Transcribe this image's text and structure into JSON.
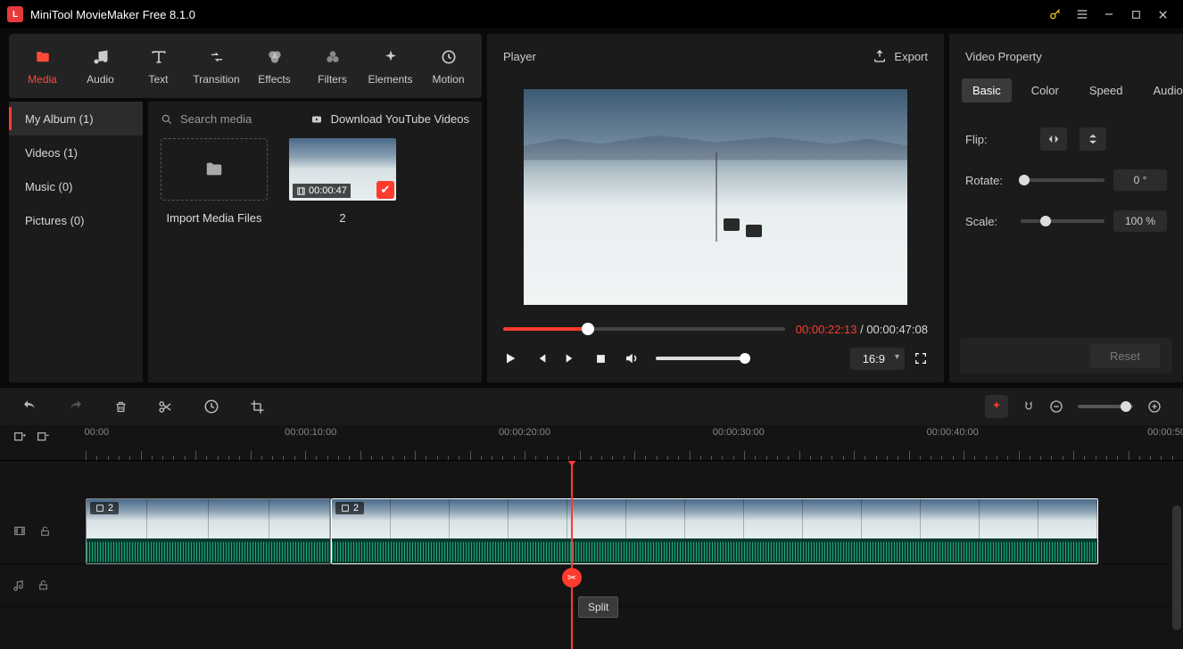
{
  "app": {
    "title": "MiniTool MovieMaker Free 8.1.0"
  },
  "toolbar": {
    "media": "Media",
    "audio": "Audio",
    "text": "Text",
    "transition": "Transition",
    "effects": "Effects",
    "filters": "Filters",
    "elements": "Elements",
    "motion": "Motion"
  },
  "categories": {
    "myalbum": "My Album (1)",
    "videos": "Videos (1)",
    "music": "Music (0)",
    "pictures": "Pictures (0)"
  },
  "media": {
    "search_placeholder": "Search media",
    "download_label": "Download YouTube Videos",
    "import_label": "Import Media Files",
    "clip_duration": "00:00:47",
    "clip_name": "2"
  },
  "player": {
    "title": "Player",
    "export": "Export",
    "time_current": "00:00:22:13",
    "time_total": "00:00:47:08",
    "aspect": "16:9"
  },
  "props": {
    "title": "Video Property",
    "tabs": {
      "basic": "Basic",
      "color": "Color",
      "speed": "Speed",
      "audio": "Audio"
    },
    "flip": "Flip:",
    "rotate": "Rotate:",
    "scale": "Scale:",
    "rotate_val": "0 °",
    "scale_val": "100 %",
    "reset": "Reset"
  },
  "timeline": {
    "labels": [
      "00:00",
      "00:00:10:00",
      "00:00:20:00",
      "00:00:30:00",
      "00:00:40:00",
      "00:00:50"
    ],
    "clip1_badge": "2",
    "clip2_badge": "2",
    "tooltip": "Split"
  }
}
